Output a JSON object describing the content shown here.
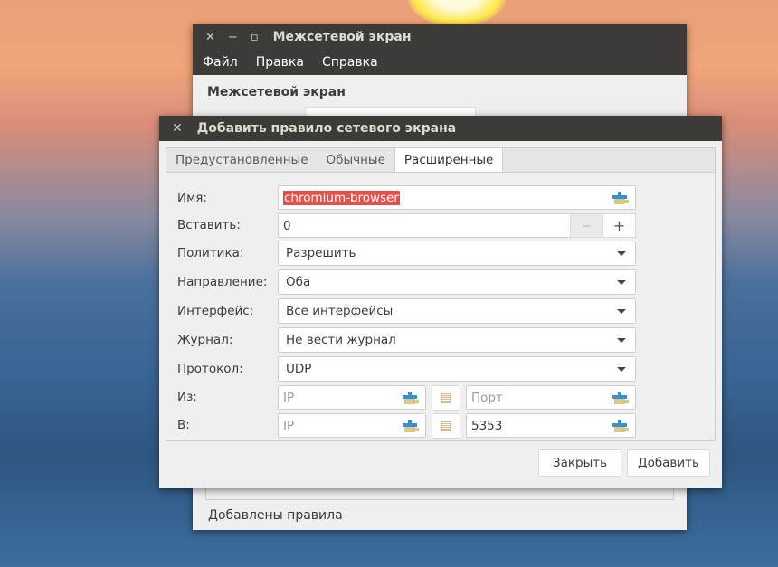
{
  "main_window": {
    "title": "Межсетевой экран",
    "menu": [
      "Файл",
      "Правка",
      "Справка"
    ],
    "heading": "Межсетевой экран",
    "footer_label": "Добавлены правила"
  },
  "dialog": {
    "title": "Добавить правило сетевого экрана",
    "tabs": [
      "Предустановленные",
      "Обычные",
      "Расширенные"
    ],
    "labels": {
      "name": "Имя:",
      "insert": "Вставить:",
      "policy": "Политика:",
      "direction": "Направление:",
      "interface": "Интерфейс:",
      "log": "Журнал:",
      "protocol": "Протокол:",
      "from": "Из:",
      "to": "В:"
    },
    "values": {
      "name": "chromium-browser",
      "insert": "0",
      "policy": "Разрешить",
      "direction": "Оба",
      "interface": "Все интерфейсы",
      "log": "Не вести журнал",
      "protocol": "UDP",
      "from_ip": "",
      "from_port": "",
      "to_ip": "",
      "to_port": "5353"
    },
    "placeholders": {
      "ip": "IP",
      "port": "Порт"
    },
    "stepper": {
      "minus": "−",
      "plus": "+"
    },
    "buttons": {
      "close": "Закрыть",
      "add": "Добавить"
    }
  }
}
